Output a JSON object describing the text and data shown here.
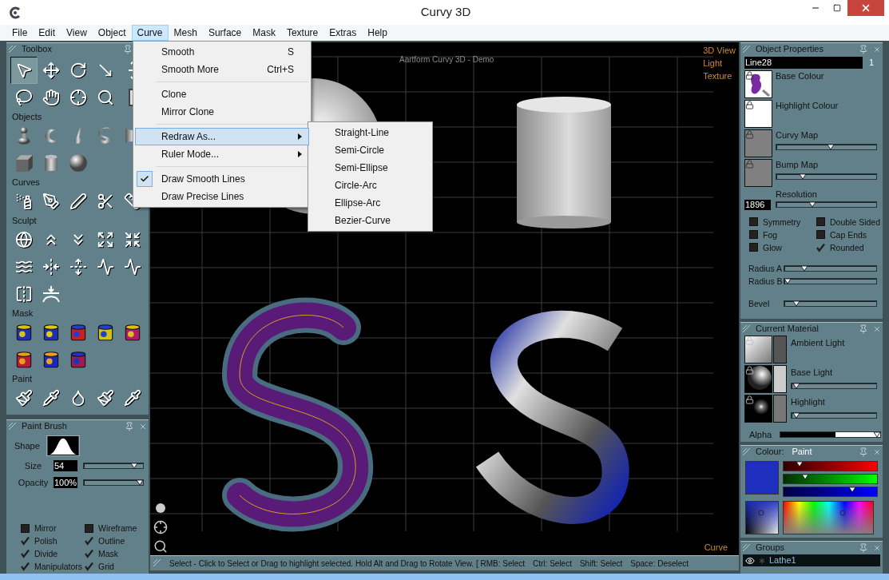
{
  "window": {
    "title": "Curvy 3D"
  },
  "menu_bar": [
    {
      "label": "File",
      "selected": false
    },
    {
      "label": "Edit",
      "selected": false
    },
    {
      "label": "View",
      "selected": false
    },
    {
      "label": "Object",
      "selected": false
    },
    {
      "label": "Curve",
      "selected": true
    },
    {
      "label": "Mesh",
      "selected": false
    },
    {
      "label": "Surface",
      "selected": false
    },
    {
      "label": "Mask",
      "selected": false
    },
    {
      "label": "Texture",
      "selected": false
    },
    {
      "label": "Extras",
      "selected": false
    },
    {
      "label": "Help",
      "selected": false
    }
  ],
  "curve_menu": {
    "items": [
      {
        "kind": "item",
        "label": "Smooth",
        "shortcut": "S",
        "selected": false,
        "checked": false,
        "submenu": false
      },
      {
        "kind": "item",
        "label": "Smooth More",
        "shortcut": "Ctrl+S",
        "selected": false,
        "checked": false,
        "submenu": false
      },
      {
        "kind": "separator"
      },
      {
        "kind": "item",
        "label": "Clone",
        "selected": false,
        "checked": false,
        "submenu": false
      },
      {
        "kind": "item",
        "label": "Mirror Clone",
        "selected": false,
        "checked": false,
        "submenu": false
      },
      {
        "kind": "separator"
      },
      {
        "kind": "item",
        "label": "Redraw As...",
        "selected": true,
        "checked": false,
        "submenu": true
      },
      {
        "kind": "item",
        "label": "Ruler Mode...",
        "selected": false,
        "checked": false,
        "submenu": true
      },
      {
        "kind": "separator"
      },
      {
        "kind": "item",
        "label": "Draw Smooth Lines",
        "selected": false,
        "checked": true,
        "submenu": false
      },
      {
        "kind": "item",
        "label": "Draw Precise Lines",
        "selected": false,
        "checked": false,
        "submenu": false
      }
    ],
    "submenu": [
      "Straight-Line",
      "Semi-Circle",
      "Semi-Ellipse",
      "Circle-Arc",
      "Ellipse-Arc",
      "Bezier-Curve"
    ]
  },
  "toolbox": {
    "title": "Toolbox",
    "sections": [
      {
        "tools": [
          {
            "kind": "select",
            "selected": true
          },
          {
            "kind": "move",
            "selected": false
          },
          {
            "kind": "rotate",
            "selected": false
          },
          {
            "kind": "scale",
            "selected": false
          },
          {
            "kind": "axis",
            "selected": false
          },
          {
            "kind": "lasso",
            "selected": false
          },
          {
            "kind": "hand",
            "selected": false
          },
          {
            "kind": "target",
            "selected": false
          },
          {
            "kind": "zoom",
            "selected": false
          },
          {
            "kind": "frame",
            "selected": false
          }
        ]
      },
      {
        "label": "Objects",
        "tools": [
          {
            "kind": "lathe",
            "selected": false
          },
          {
            "kind": "hook",
            "selected": false
          },
          {
            "kind": "spout",
            "selected": false
          },
          {
            "kind": "letter",
            "selected": false
          },
          {
            "kind": "tube",
            "selected": false
          },
          {
            "kind": "cube",
            "selected": false
          },
          {
            "kind": "cylinder",
            "selected": false
          },
          {
            "kind": "sphere",
            "selected": false
          }
        ]
      },
      {
        "label": "Curves",
        "tools": [
          {
            "kind": "spray",
            "selected": false
          },
          {
            "kind": "penr",
            "selected": false
          },
          {
            "kind": "pen",
            "selected": false
          },
          {
            "kind": "scissors",
            "selected": false
          },
          {
            "kind": "ruler",
            "selected": false
          }
        ]
      },
      {
        "label": "Sculpt",
        "tools": [
          {
            "kind": "globe",
            "selected": false
          },
          {
            "kind": "raise",
            "selected": false
          },
          {
            "kind": "lower",
            "selected": false
          },
          {
            "kind": "expand",
            "selected": false
          },
          {
            "kind": "shrink",
            "selected": false
          },
          {
            "kind": "twist",
            "selected": false
          },
          {
            "kind": "pinch",
            "selected": false
          },
          {
            "kind": "smooth",
            "selected": false
          },
          {
            "kind": "bulge",
            "selected": false
          },
          {
            "kind": "wave",
            "selected": false
          },
          {
            "kind": "mirror",
            "selected": false
          },
          {
            "kind": "flatten",
            "selected": false
          }
        ]
      },
      {
        "label": "Mask",
        "tools": [
          {
            "kind": "mask",
            "selected": false
          },
          {
            "kind": "mask",
            "selected": false
          },
          {
            "kind": "mask",
            "selected": false
          },
          {
            "kind": "mask",
            "selected": false
          },
          {
            "kind": "mask",
            "selected": false
          },
          {
            "kind": "mask",
            "selected": false
          },
          {
            "kind": "mask",
            "selected": false
          },
          {
            "kind": "mask",
            "selected": false
          }
        ]
      },
      {
        "label": "Paint",
        "tools": [
          {
            "kind": "brush",
            "selected": false
          },
          {
            "kind": "dropper",
            "selected": false
          },
          {
            "kind": "nozzle",
            "selected": false
          },
          {
            "kind": "brush",
            "selected": false
          },
          {
            "kind": "dropper",
            "selected": false
          }
        ]
      }
    ]
  },
  "paint_brush": {
    "title": "Paint Brush",
    "shape_label": "Shape",
    "fields": [
      {
        "label": "Size",
        "value": "54",
        "level": 0.9
      },
      {
        "label": "Opacity",
        "value": "100%",
        "level": 1.0
      }
    ],
    "options": [
      {
        "label": "Mirror",
        "checked": false
      },
      {
        "label": "Wireframe",
        "checked": false
      },
      {
        "label": "Polish",
        "checked": true
      },
      {
        "label": "Outline",
        "checked": true
      },
      {
        "label": "Divide",
        "checked": true
      },
      {
        "label": "Mask",
        "checked": true
      },
      {
        "label": "Manipulators",
        "checked": true
      },
      {
        "label": "Grid",
        "checked": true
      }
    ]
  },
  "viewport": {
    "caption": "Aartform Curvy 3D - Demo",
    "view_modes": [
      "3D View",
      "Light",
      "Texture"
    ],
    "mode": "Curve"
  },
  "status_bar": [
    "Select - Click to Select or Drag to highlight selected. Hold Alt and Drag to Rotate View. [ RMB: Select",
    "Ctrl: Select",
    "Shift: Select",
    "Space: Deselect"
  ],
  "object_properties": {
    "title": "Object Properties",
    "name": "Line28",
    "count": "1",
    "maps": [
      {
        "label": "Base Colour",
        "kind": "painted"
      },
      {
        "label": "Highlight Colour",
        "kind": "blank"
      },
      {
        "label": "Curvy Map",
        "kind": "empty",
        "level": 0.55
      },
      {
        "label": "Bump Map",
        "kind": "empty",
        "level": 0.25
      }
    ],
    "resolution": {
      "label": "Resolution",
      "value": "1896",
      "level": 0.35
    },
    "options": [
      {
        "label": "Symmetry",
        "checked": false
      },
      {
        "label": "Double Sided",
        "checked": false
      },
      {
        "label": "Fog",
        "checked": false
      },
      {
        "label": "Cap Ends",
        "checked": false
      },
      {
        "label": "Glow",
        "checked": false
      },
      {
        "label": "Rounded",
        "checked": true
      }
    ],
    "sliders": [
      {
        "label": "Radius A",
        "level": 0.2
      },
      {
        "label": "Radius B",
        "level": 0.0
      },
      {
        "label": "Bevel",
        "level": 0.1
      }
    ]
  },
  "current_material": {
    "title": "Current Material",
    "rows": [
      {
        "label": "Ambient Light",
        "kind": "ambient",
        "color": "#555555"
      },
      {
        "label": "Base Light",
        "kind": "sphere",
        "color": "#cccccc",
        "level": 0.02
      },
      {
        "label": "Highlight",
        "kind": "glow",
        "color": "#777777",
        "level": 0.02
      }
    ],
    "alpha": {
      "label": "Alpha",
      "level": 1.0
    }
  },
  "colour": {
    "title": "Colour:",
    "target": "Paint",
    "color": "#1f2fc0",
    "channels": [
      {
        "kind": "red",
        "level": 0.15
      },
      {
        "kind": "green",
        "level": 0.21
      },
      {
        "kind": "blue",
        "level": 0.75
      }
    ]
  },
  "groups": {
    "title": "Groups",
    "items": [
      {
        "label": "Lathe1",
        "visible": true
      }
    ]
  }
}
